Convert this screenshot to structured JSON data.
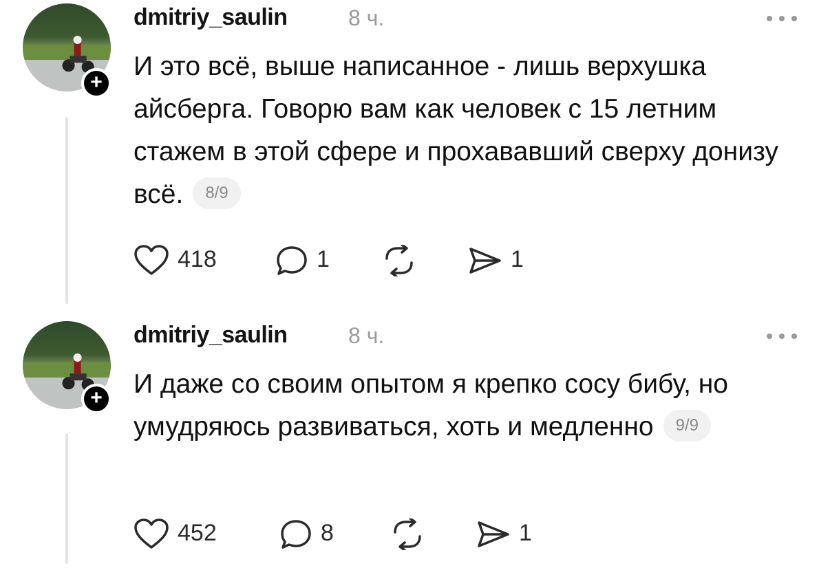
{
  "posts": [
    {
      "username": "dmitriy_saulin",
      "time": "8 ч.",
      "text": "И это всё, выше написанное - лишь верхушка айсберга. Говорю вам как человек с 15 летним стажем в этой сфере и прохававший сверху донизу всё.",
      "pager": "8/9",
      "likes": "418",
      "replies": "1",
      "shares": "1"
    },
    {
      "username": "dmitriy_saulin",
      "time": "8 ч.",
      "text": "И даже со своим опытом я крепко сосу бибу, но умудряюсь развиваться, хоть и медленно",
      "pager": "9/9",
      "likes": "452",
      "replies": "8",
      "shares": "1"
    }
  ],
  "icons": {
    "follow": "plus-icon",
    "more": "more-icon",
    "like": "heart-icon",
    "reply": "comment-icon",
    "repost": "repost-icon",
    "share": "send-icon"
  },
  "colors": {
    "text": "#111111",
    "muted": "#9a9a9a",
    "icon": "#2a2a2a"
  }
}
